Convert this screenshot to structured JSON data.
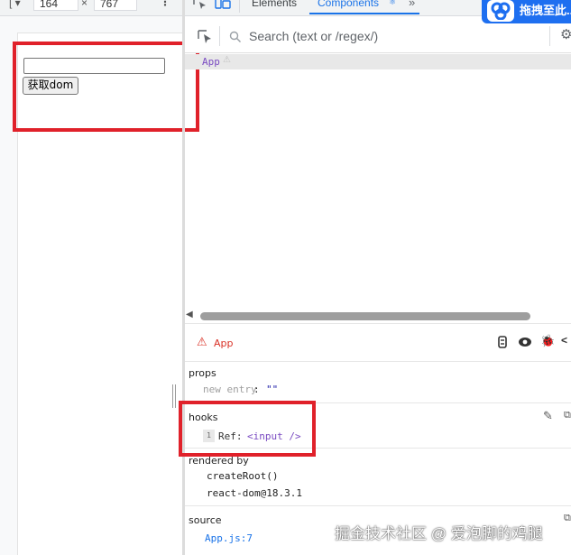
{
  "device_toolbar": {
    "width": "164",
    "times": "×",
    "height": "767"
  },
  "page": {
    "input_value": "",
    "button_label": "获取dom"
  },
  "tabs": {
    "elements": "Elements",
    "components": "Components"
  },
  "baidu_overlay": {
    "label": "拖拽至此..."
  },
  "search": {
    "placeholder": "Search (text or /regex/)"
  },
  "tree": {
    "root": "App"
  },
  "details": {
    "component_name": "App",
    "props_title": "props",
    "prop_key": "new entry",
    "prop_value": "\"\"",
    "hooks_title": "hooks",
    "hook_index": "1",
    "hook_name": "Ref:",
    "hook_value": "<input />",
    "rendered_by_title": "rendered by",
    "rendered_by": [
      "createRoot()",
      "react-dom@18.3.1"
    ],
    "source_title": "source",
    "source_value": "App.js:7"
  },
  "watermark": "掘金技术社区 @ 爱泡脚的鸡腿",
  "colors": {
    "accent": "#1a73e8",
    "highlight_box": "#e0212a",
    "error": "#d93025",
    "baidu": "#1e6ff0"
  }
}
